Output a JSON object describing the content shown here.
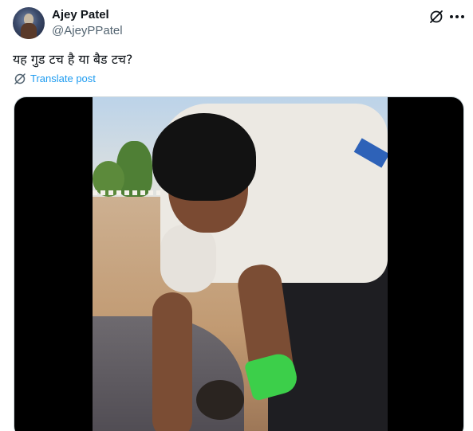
{
  "author": {
    "display_name": "Ajey Patel",
    "handle": "@AjeyPPatel",
    "avatar_icon": "profile-avatar"
  },
  "header_actions": {
    "grok_icon": "grok-icon",
    "more_icon": "more-options-icon"
  },
  "post": {
    "text": "यह गुड टच है या बैड टच?",
    "translate_label": "Translate post",
    "translate_icon": "translate-icon"
  },
  "media": {
    "type": "video",
    "icon": "video-thumbnail"
  },
  "colors": {
    "accent": "#1d9bf0",
    "text_primary": "#0f1419",
    "text_secondary": "#536471",
    "border": "#cfd9de"
  }
}
